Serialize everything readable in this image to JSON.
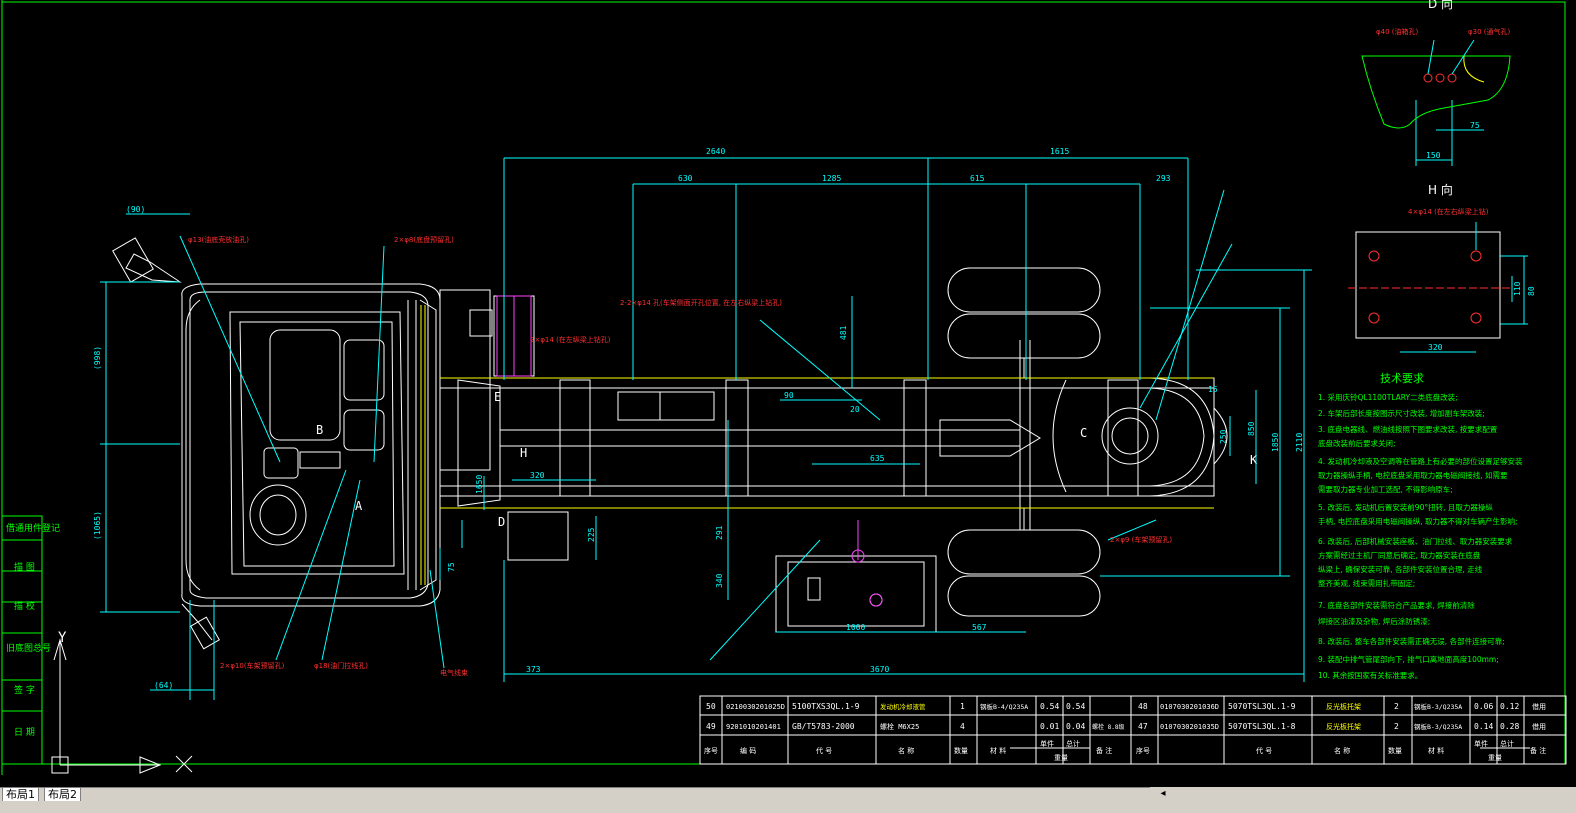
{
  "view": {
    "label_d_view": "D 向",
    "label_h_view": "H 向",
    "marks": {
      "a": "A",
      "b": "B",
      "c": "C",
      "d": "D",
      "e": "E",
      "h": "H",
      "k": "K"
    }
  },
  "dimensions": {
    "d2640": "2640",
    "d1615": "1615",
    "d630": "630",
    "d1285": "1285",
    "d615": "615",
    "d293": "293",
    "d90": "(90)",
    "d998": "(998)",
    "d1065": "(1065)",
    "d64": "(64)",
    "d373": "373",
    "d3670": "3670",
    "d481": "481",
    "d320": "320",
    "d1650": "1650",
    "d635": "635",
    "d291": "291",
    "d340": "340",
    "d1000": "1000",
    "d567": "567",
    "d15": "15",
    "d850": "850",
    "d1850": "1850",
    "d2110": "2110",
    "d225": "225",
    "d250": "250",
    "d75": "75",
    "d150": "150",
    "d75b": "75",
    "d320b": "320",
    "d110": "110",
    "d80": "80",
    "d90b": "90",
    "d20": "20"
  },
  "annotations": {
    "a_phi13": "φ13(油底壳放油孔)",
    "a_2xphi8": "2×φ8(底盘预留孔)",
    "a_2xphi14_top": "2-2×φ14 孔(车架侧面开孔位置, 在左右纵梁上钻孔)",
    "a_2xphi14_mid": "2×φ14 (在左纵梁上钻孔)",
    "a_2xphi10": "2×φ10(车架预留孔)",
    "a_phi18": "φ18(油门拉线孔)",
    "a_elec": "电气线束",
    "a_2xphi9": "2×φ9 (车架预留孔)",
    "a_phi40": "φ40 (油箱孔)",
    "a_phi30": "φ30 (通气孔)",
    "a_4xphi14": "4×φ14 (在左右纵梁上钻)"
  },
  "tech_requirements": {
    "title": "技术要求",
    "items": [
      "1. 采用庆铃QL1100TLARY二类底盘改装;",
      "2. 车架后部长度按图示尺寸改装, 增加副车架改装;",
      "3. 底盘电器线、燃油线按照下图要求改装, 按要求配置",
      "   底盘改装前后要求关闭;",
      "4. 发动机冷却液及空调等在管路上有必要的部位设置足够安装",
      "   取力器操纵手柄, 电控底盘采用取力器电磁阀接线, 如需要",
      "   需要取力器专业加工选配, 不得影响原车;",
      "5. 改装后, 发动机后置安装前90°扭转, 且取力器操纵",
      "   手柄, 电控底盘采用电磁阀操纵, 取力器不得对车辆产生影响;",
      "6. 改装后, 后部机械安装座板、油门拉线、取力器安装要求",
      "   方案需经过主机厂同意后确定, 取力器安装在底盘",
      "   纵梁上, 确保安装可靠, 各部件安装位置合理, 走线",
      "   整齐美观, 线束需用扎带固定;",
      "7. 底盘各部件安装需符合产品要求, 焊接前清除",
      "   焊接区油漆及杂物, 焊后涂防锈漆;",
      "8. 改装后, 整车各部件安装需正确无误, 各部件连接可靠;",
      "9. 装配中排气管尾部向下, 排气口离地面高度100mm;",
      "10. 其余按国家有关标准要求。"
    ]
  },
  "title_block": {
    "rows": [
      [
        "50",
        "0210030201025D",
        "5100TXS3QL.1-9",
        "发动机冷却液管",
        "1",
        "钢板B-4/Q235A",
        "0.54",
        "0.54",
        ""
      ],
      [
        "49",
        "9201010201401",
        "GB/T5783-2000",
        "螺栓 M6X25",
        "4",
        "",
        "0.01",
        "0.04",
        "螺栓 8.8级"
      ],
      [
        "48",
        "0107030201036D",
        "5070TSL3QL.1-9",
        "反光板托架",
        "2",
        "钢板B-3/Q235A",
        "0.06",
        "0.12",
        "借用"
      ],
      [
        "47",
        "0107030201035D",
        "5070TSL3QL.1-8",
        "反光板托架",
        "2",
        "钢板B-3/Q235A",
        "0.14",
        "0.28",
        "借用"
      ]
    ],
    "headers_left": [
      "序号",
      "编  码",
      "代  号",
      "名  称",
      "数量",
      "材  料",
      "单件",
      "总计",
      "备  注"
    ],
    "headers_right": [
      "序号",
      "代  号",
      "名  称",
      "数量",
      "材  料",
      "单件",
      "总计",
      "备  注"
    ],
    "weight_label": "重量",
    "weight_sub_unit": "单件",
    "weight_sub_total": "总计"
  },
  "revision_block": {
    "items": [
      "借通用件登记",
      "描 图",
      "描 校",
      "旧底图总号",
      "签 字",
      "日 期"
    ]
  },
  "ucs": {
    "y_label": "Y"
  },
  "tabs": {
    "layout1": "布局1",
    "layout2": "布局2"
  },
  "colors": {
    "frame": "#00ff00",
    "dim": "#00ffff",
    "geometry": "#ffffff",
    "yellow": "#ffff00",
    "red": "#ff3030",
    "magenta": "#ff40ff",
    "background": "#000000"
  }
}
